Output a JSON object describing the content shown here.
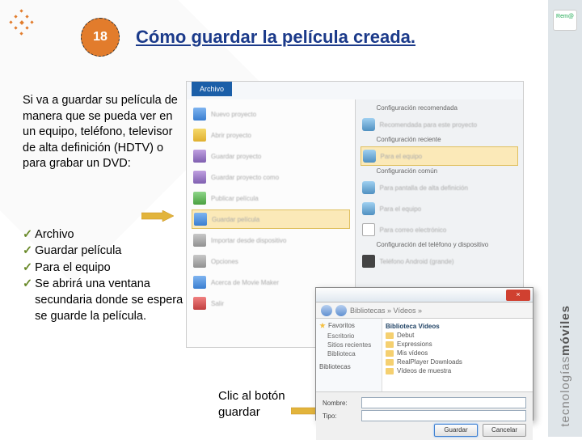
{
  "header": {
    "badge": "18",
    "title": "Cómo guardar la película creada."
  },
  "body_text": "Si va a guardar su película de manera que se pueda ver en un equipo, teléfono, televisor de alta definición (HDTV) o para grabar un DVD:",
  "steps": [
    "Archivo",
    "Guardar película",
    "Para el equipo",
    "Se abrirá una ventana secundaria donde se espera se guarde la película."
  ],
  "caption_line1": "Clic al botón",
  "caption_line2": "guardar",
  "sidebar": {
    "brand1": "tecnologías",
    "brand2": "móviles",
    "logo": "Rem@"
  },
  "screenshot": {
    "tab": "Archivo",
    "left_items": [
      "Nuevo proyecto",
      "Abrir proyecto",
      "Guardar proyecto",
      "Guardar proyecto como",
      "Publicar película",
      "Guardar película",
      "Importar desde dispositivo",
      "Opciones",
      "Acerca de Movie Maker",
      "Salir"
    ],
    "right_sections": {
      "s1": {
        "label": "Configuración recomendada",
        "items": [
          "Recomendada para este proyecto"
        ]
      },
      "s2": {
        "label": "Configuración reciente",
        "items": [
          "Para el equipo"
        ]
      },
      "s3": {
        "label": "Configuración común",
        "items": [
          "Para pantalla de alta definición",
          "Para el equipo",
          "Para correo electrónico"
        ]
      },
      "s4": {
        "label": "Configuración del teléfono y dispositivo",
        "items": [
          "Teléfono Android (grande)"
        ]
      }
    }
  },
  "dialog": {
    "path": "Bibliotecas » Vídeos »",
    "side_head": "Favoritos",
    "side_items": [
      "Escritorio",
      "Sitios recientes",
      "Biblioteca"
    ],
    "side_head2": "Bibliotecas",
    "files_head": "Biblioteca Vídeos",
    "files": [
      "Debut",
      "Expressions",
      "Mis vídeos",
      "RealPlayer Downloads",
      "Vídeos de muestra"
    ],
    "name_label": "Nombre:",
    "type_label": "Tipo:",
    "save_btn": "Guardar",
    "cancel_btn": "Cancelar"
  }
}
